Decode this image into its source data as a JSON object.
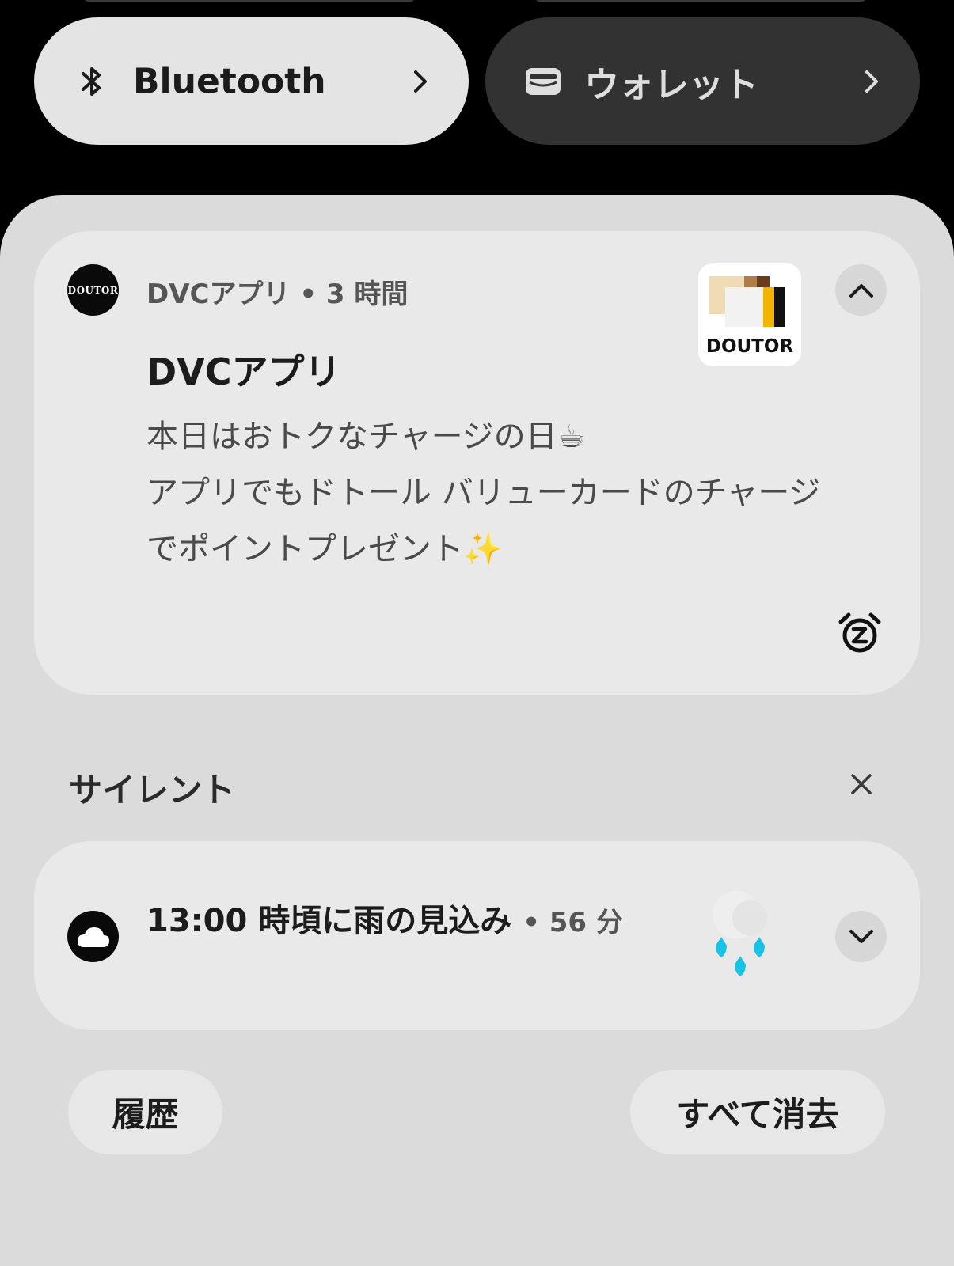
{
  "quick_settings": {
    "bluetooth": {
      "label": "Bluetooth",
      "icon": "bluetooth-icon"
    },
    "wallet": {
      "label": "ウォレット",
      "icon": "wallet-icon"
    }
  },
  "notifications": {
    "dvc": {
      "app_name": "DVCアプリ",
      "time": "3 時間",
      "title": "DVCアプリ",
      "body_lines": [
        "本日はおトクなチャージの日☕",
        "アプリでもドトール バリューカードのチャージ",
        "でポイントプレゼント✨"
      ],
      "avatar_text": "DOUTOR",
      "logo_text": "DOUTOR"
    },
    "silent_section": {
      "label": "サイレント"
    },
    "weather": {
      "title": "13:00 時頃に雨の見込み",
      "time": "56 分"
    }
  },
  "actions": {
    "history_label": "履歴",
    "clear_all_label": "すべて消去"
  },
  "colors": {
    "shade_bg": "#dbdbdb",
    "card_bg": "#e9e9e9",
    "wallet_tile_bg": "#323232",
    "rain_drop": "#19c3e8"
  }
}
